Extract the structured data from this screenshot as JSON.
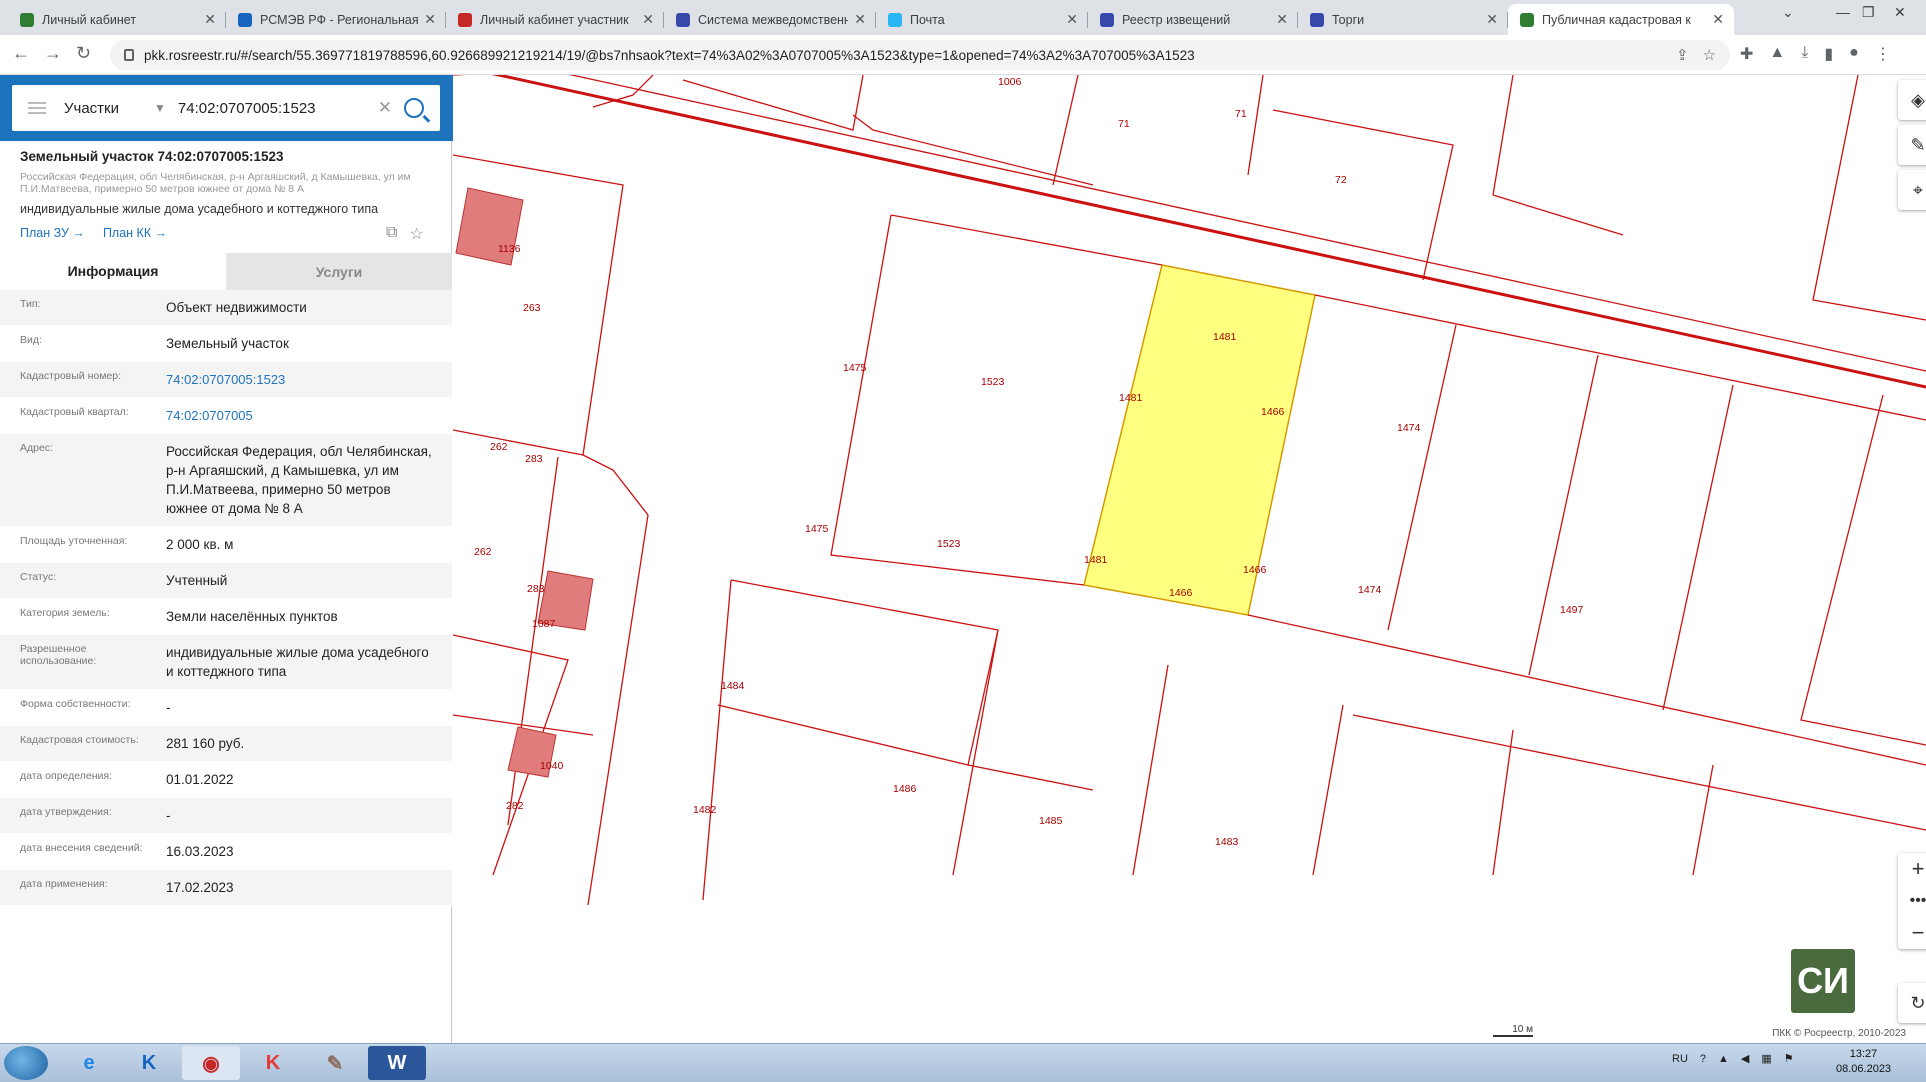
{
  "browser": {
    "tabs": [
      {
        "title": "Личный кабинет",
        "color": "#2e7d32"
      },
      {
        "title": "РСМЭВ РФ - Региональная",
        "color": "#1565c0"
      },
      {
        "title": "Личный кабинет участник",
        "color": "#c62828"
      },
      {
        "title": "Система межведомственн",
        "color": "#3949ab"
      },
      {
        "title": "Почта",
        "color": "#29b6f6"
      },
      {
        "title": "Реестр извещений",
        "color": "#3949ab"
      },
      {
        "title": "Торги",
        "color": "#3949ab"
      },
      {
        "title": "Публичная кадастровая к",
        "color": "#2e7d32"
      }
    ],
    "url": "pkk.rosreestr.ru/#/search/55.369771819788596,60.926689921219214/19/@bs7nhsaok?text=74%3A02%3A0707005%3A1523&type=1&opened=74%3A2%3A707005%3A1523"
  },
  "search": {
    "type_label": "Участки",
    "query": "74:02:0707005:1523"
  },
  "object": {
    "title": "Земельный участок 74:02:0707005:1523",
    "address_small": "Российская Федерация, обл Челябинская, р-н Аргаяшский, д Камышевка, ул им П.И.Матвеева, примерно 50 метров южнее от дома № 8 А",
    "use": "индивидуальные жилые дома усадебного и коттеджного типа",
    "plan_zu": "План ЗУ →",
    "plan_kk": "План КК →"
  },
  "panel_tabs": {
    "info": "Информация",
    "services": "Услуги"
  },
  "properties": [
    {
      "key": "Тип:",
      "value": "Объект недвижимости",
      "link": false
    },
    {
      "key": "Вид:",
      "value": "Земельный участок",
      "link": false
    },
    {
      "key": "Кадастровый номер:",
      "value": "74:02:0707005:1523",
      "link": true
    },
    {
      "key": "Кадастровый квартал:",
      "value": "74:02:0707005",
      "link": true
    },
    {
      "key": "Адрес:",
      "value": "Российская Федерация, обл Челябинская, р-н Аргаяшский, д Камышевка, ул им П.И.Матвеева, примерно 50 метров южнее от дома № 8 А",
      "link": false
    },
    {
      "key": "Площадь уточненная:",
      "value": "2 000 кв. м",
      "link": false
    },
    {
      "key": "Статус:",
      "value": "Учтенный",
      "link": false
    },
    {
      "key": "Категория земель:",
      "value": "Земли населённых пунктов",
      "link": false
    },
    {
      "key": "Разрешенное использование:",
      "value": "индивидуальные жилые дома усадебного и коттеджного типа",
      "link": false
    },
    {
      "key": "Форма собственности:",
      "value": "-",
      "link": false
    },
    {
      "key": "Кадастровая стоимость:",
      "value": "281 160 руб.",
      "link": false
    },
    {
      "key": "дата определения:",
      "value": "01.01.2022",
      "link": false
    },
    {
      "key": "дата утверждения:",
      "value": "-",
      "link": false
    },
    {
      "key": "дата внесения сведений:",
      "value": "16.03.2023",
      "link": false
    },
    {
      "key": "дата применения:",
      "value": "17.02.2023",
      "link": false
    }
  ],
  "map": {
    "labels": [
      "1006",
      "71",
      "71",
      "72",
      "1136",
      "263",
      "1475",
      "1523",
      "1481",
      "1481",
      "1466",
      "1474",
      "262",
      "283",
      "1475",
      "1523",
      "262",
      "1481",
      "1466",
      "1466",
      "1474",
      "1497",
      "283",
      "1087",
      "1484",
      "1040",
      "1486",
      "1482",
      "1485",
      "282",
      "1483"
    ],
    "highlight_color": "#ffff80",
    "boundary_color": "#cc0000",
    "copyright": "ПКК © Росреестр, 2010-2023",
    "scale": "10 м",
    "layer_thumb": "СИ"
  },
  "taskbar": {
    "lang": "RU",
    "time": "13:27",
    "date": "08.06.2023"
  }
}
